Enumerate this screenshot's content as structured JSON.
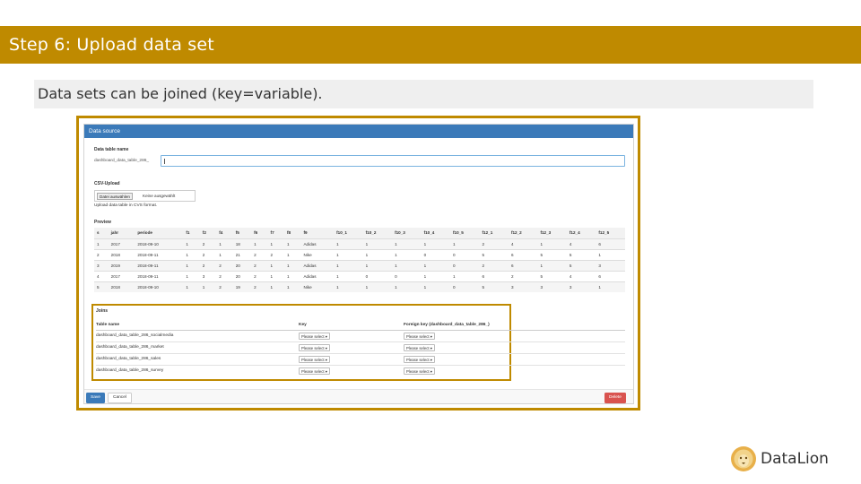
{
  "slide": {
    "title": "Step 6: Upload data set",
    "subtitle": "Data sets can be joined (key=variable)."
  },
  "panel": {
    "heading": "Data source",
    "name_label": "Data table name",
    "name_prefix": "dashboard_data_table_286_",
    "csv_label": "CSV-Upload",
    "file_button": "Datei auswählen",
    "file_status": "Keine ausgewählt",
    "file_help": "Upload data table in CVS format.",
    "preview_label": "Preview",
    "preview_columns": [
      "s",
      "jahr",
      "periode",
      "f1",
      "f2",
      "f4",
      "f5",
      "f6",
      "f7",
      "f8",
      "f9",
      "f10_1",
      "f10_2",
      "f10_3",
      "f10_4",
      "f10_5",
      "f12_1",
      "f12_2",
      "f12_3",
      "f12_4",
      "f12_5"
    ],
    "preview_rows": [
      [
        "1",
        "2017",
        "2018-09-10",
        "1",
        "2",
        "1",
        "18",
        "1",
        "1",
        "1",
        "Adidas",
        "1",
        "1",
        "1",
        "1",
        "1",
        "2",
        "4",
        "1",
        "4",
        "6"
      ],
      [
        "2",
        "2018",
        "2018-09-11",
        "1",
        "2",
        "1",
        "21",
        "2",
        "2",
        "1",
        "Nike",
        "1",
        "1",
        "1",
        "0",
        "0",
        "5",
        "6",
        "5",
        "5",
        "1"
      ],
      [
        "3",
        "2019",
        "2018-09-11",
        "1",
        "2",
        "2",
        "20",
        "2",
        "1",
        "1",
        "Adidas",
        "1",
        "1",
        "1",
        "1",
        "0",
        "2",
        "6",
        "1",
        "5",
        "3"
      ],
      [
        "4",
        "2017",
        "2018-09-11",
        "1",
        "3",
        "2",
        "20",
        "2",
        "1",
        "1",
        "Adidas",
        "1",
        "0",
        "0",
        "1",
        "1",
        "6",
        "2",
        "5",
        "4",
        "6"
      ],
      [
        "5",
        "2018",
        "2018-09-10",
        "1",
        "1",
        "2",
        "19",
        "2",
        "1",
        "1",
        "Nike",
        "1",
        "1",
        "1",
        "1",
        "0",
        "5",
        "3",
        "3",
        "3",
        "1"
      ]
    ],
    "joins": {
      "label": "Joins",
      "col_table": "Table name",
      "col_key": "Key",
      "col_foreign": "Foreign key (dashboard_data_table_286_)",
      "rows": [
        {
          "table": "dashboard_data_table_286_socialmedia",
          "key": "Please select",
          "foreign": "Please select"
        },
        {
          "table": "dashboard_data_table_286_market",
          "key": "Please select",
          "foreign": "Please select"
        },
        {
          "table": "dashboard_data_table_286_sales",
          "key": "Please select",
          "foreign": "Please select"
        },
        {
          "table": "dashboard_data_table_286_survey",
          "key": "Please select",
          "foreign": "Please select"
        }
      ]
    },
    "buttons": {
      "save": "Save",
      "cancel": "Cancel",
      "delete": "Delete"
    }
  },
  "logo": {
    "text": "DataLion"
  },
  "colors": {
    "accent": "#bf8a00",
    "panel_heading": "#3b7ab9",
    "danger": "#d9534f"
  }
}
